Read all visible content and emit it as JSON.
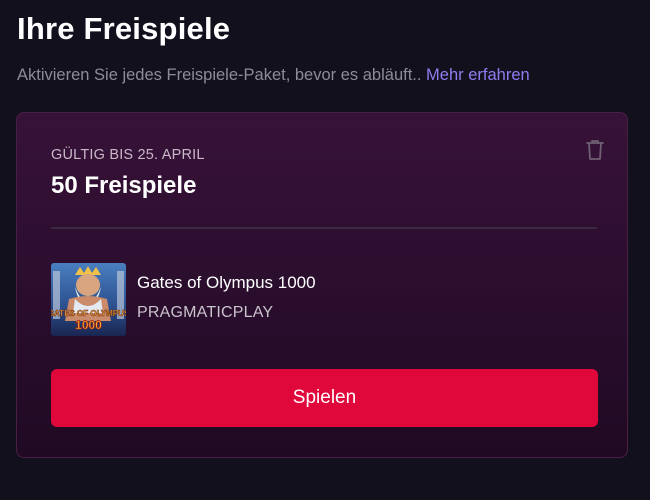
{
  "header": {
    "title": "Ihre Freispiele",
    "subtitle": "Aktivieren Sie jedes Freispiele-Paket, bevor es abläuft..",
    "more_link": "Mehr erfahren"
  },
  "offer": {
    "validity": "GÜLTIG BIS 25. APRIL",
    "title": "50 Freispiele",
    "delete_icon": "trash-icon",
    "game": {
      "name": "Gates of Olympus 1000",
      "provider": "PRAGMATICPLAY",
      "thumbnail_text_top": "GATES OF OLYMPUS",
      "thumbnail_text_bottom": "1000"
    },
    "play_label": "Spielen"
  },
  "colors": {
    "background": "#13101d",
    "card": "#331136",
    "accent_link": "#8f7cf0",
    "play_button": "#e0073b"
  }
}
